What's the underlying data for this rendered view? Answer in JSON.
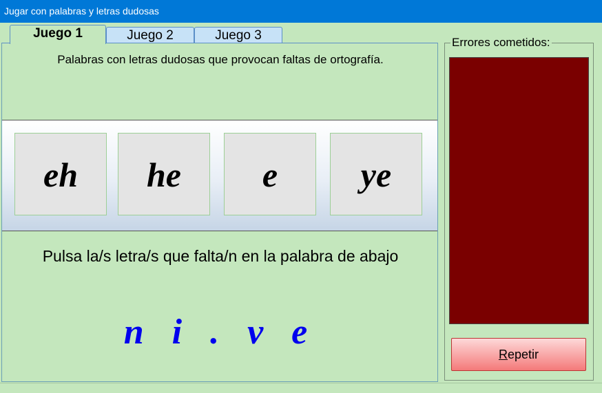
{
  "window": {
    "title": "Jugar con palabras y letras dudosas"
  },
  "tabs": [
    {
      "label": "Juego 1",
      "active": true
    },
    {
      "label": "Juego 2",
      "active": false
    },
    {
      "label": "Juego 3",
      "active": false
    }
  ],
  "game": {
    "instruction": "Palabras con letras dudosas que provocan faltas de ortografía.",
    "options": [
      "eh",
      "he",
      "e",
      "ye"
    ],
    "prompt": "Pulsa la/s letra/s que falta/n en la palabra de abajo",
    "puzzle_word": "n i . v e"
  },
  "errors": {
    "label": "Errores cometidos:",
    "display_color": "#7a0000"
  },
  "buttons": {
    "repeat_first": "R",
    "repeat_rest": "epetir"
  },
  "colors": {
    "background": "#c4e7bd",
    "titlebar": "#0078d7",
    "puzzle_text": "#0000ee"
  }
}
